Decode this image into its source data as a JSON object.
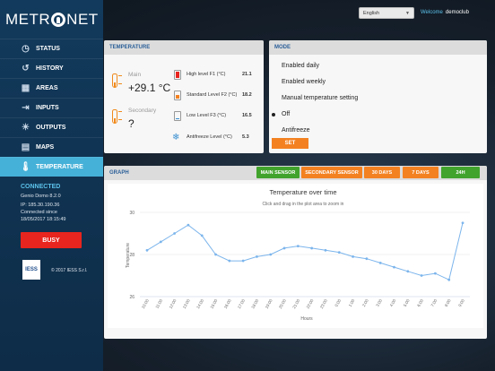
{
  "app": {
    "logo_text": "METRONET"
  },
  "topbar": {
    "language": "English",
    "welcome_label": "Welcome",
    "username": "democlub"
  },
  "sidebar": {
    "items": [
      {
        "label": "STATUS",
        "icon": "dashboard-icon",
        "active": false
      },
      {
        "label": "HISTORY",
        "icon": "clock-icon",
        "active": false
      },
      {
        "label": "AREAS",
        "icon": "grid-icon",
        "active": false
      },
      {
        "label": "INPUTS",
        "icon": "input-icon",
        "active": false
      },
      {
        "label": "OUTPUTS",
        "icon": "lightbulb-icon",
        "active": false
      },
      {
        "label": "MAPS",
        "icon": "map-icon",
        "active": false
      },
      {
        "label": "TEMPERATURE",
        "icon": "thermometer-icon",
        "active": true
      }
    ],
    "status": {
      "title": "CONNECTED",
      "device": "Genio Domo 8.2.0",
      "ip": "IP: 185.30.190.36",
      "connected_since_label": "Connected since",
      "connected_since": "18/05/2017 18:15:49"
    },
    "busy_label": "BUSY",
    "iess_logo": "IESS",
    "copyright": "© 2017 IESS S.r.l."
  },
  "temperature_panel": {
    "header": "TEMPERATURE",
    "main_label": "Main",
    "main_value": "+29.1 °C",
    "secondary_label": "Secondary",
    "secondary_value": "?",
    "levels": [
      {
        "label": "High level F1 (°C)",
        "value": "21.1",
        "color": "#e8251e"
      },
      {
        "label": "Standard Level F2 (°C)",
        "value": "18.2",
        "color": "#f38121"
      },
      {
        "label": "Low Level F3 (°C)",
        "value": "16.5",
        "color": "#3b90d1"
      },
      {
        "label": "Antifreeze Level (°C)",
        "value": "5.3",
        "color": "#3b90d1"
      }
    ]
  },
  "mode_panel": {
    "header": "MODE",
    "options": [
      {
        "label": "Enabled daily",
        "selected": false
      },
      {
        "label": "Enabled weekly",
        "selected": false
      },
      {
        "label": "Manual temperature setting",
        "selected": false
      },
      {
        "label": "Off",
        "selected": true
      },
      {
        "label": "Antifreeze",
        "selected": false
      }
    ],
    "set_label": "SET"
  },
  "graph_panel": {
    "header": "GRAPH",
    "buttons": [
      {
        "label": "MAIN SENSOR",
        "color": "green"
      },
      {
        "label": "SECONDARY SENSOR",
        "color": "orange"
      },
      {
        "label": "30 DAYS",
        "color": "orange"
      },
      {
        "label": "7 DAYS",
        "color": "orange"
      },
      {
        "label": "24H",
        "color": "green"
      }
    ]
  },
  "chart_data": {
    "type": "line",
    "title": "Temperature over time",
    "subtitle": "Click and drag in the plot area to zoom in",
    "xlabel": "Hours",
    "ylabel": "Temperature",
    "ylim": [
      26,
      30
    ],
    "yticks": [
      26,
      28,
      30
    ],
    "grid": true,
    "line_color": "#7cb5ec",
    "x": [
      "10:00",
      "11:00",
      "12:00",
      "13:00",
      "14:00",
      "15:00",
      "16:00",
      "17:00",
      "18:00",
      "19:00",
      "20:00",
      "21:00",
      "22:00",
      "23:00",
      "0:00",
      "1:00",
      "2:00",
      "3:00",
      "4:00",
      "5:00",
      "6:00",
      "7:00",
      "8:00",
      "9:00"
    ],
    "values": [
      28.2,
      28.6,
      29.0,
      29.4,
      28.9,
      28.0,
      27.7,
      27.7,
      27.9,
      28.0,
      28.3,
      28.4,
      28.3,
      28.2,
      28.1,
      27.9,
      27.8,
      27.6,
      27.4,
      27.2,
      27.0,
      27.1,
      26.8,
      29.5
    ]
  }
}
